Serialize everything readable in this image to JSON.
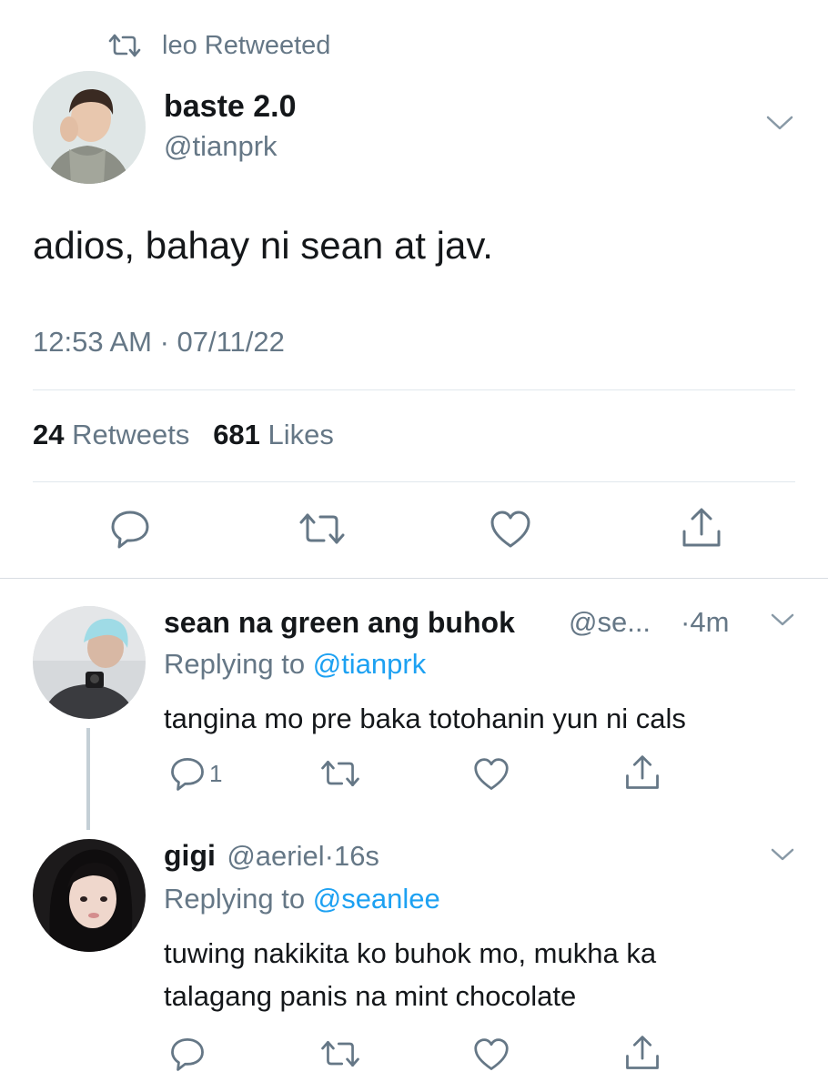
{
  "retweet_header": {
    "text": "leo Retweeted"
  },
  "main_tweet": {
    "display_name": "baste 2.0",
    "handle": "@tianprk",
    "text": "adios, bahay ni sean at jav.",
    "timestamp": "12:53 AM · 07/11/22",
    "retweets_count": "24",
    "retweets_label": "Retweets",
    "likes_count": "681",
    "likes_label": "Likes"
  },
  "replies": [
    {
      "display_name": "sean na green ang buhok",
      "handle": "@se...",
      "time": "·4m",
      "replying_prefix": "Replying to",
      "replying_handle": "@tianprk",
      "text": "tangina mo pre baka totohanin yun ni cals",
      "reply_count": "1"
    },
    {
      "display_name": "gigi",
      "handle": "@aeriel",
      "time": "·16s",
      "replying_prefix": "Replying to",
      "replying_handle": "@seanlee",
      "text_line1": "tuwing nakikita ko buhok mo, mukha ka",
      "text_line2": "talagang panis na mint chocolate"
    }
  ],
  "icons": [
    "retweet-icon",
    "chevron-down-icon",
    "reply-icon",
    "like-icon",
    "share-icon"
  ],
  "colors": {
    "text": "#14171a",
    "secondary": "#657786",
    "link": "#1da1f2",
    "divider": "#e1e8ed"
  }
}
